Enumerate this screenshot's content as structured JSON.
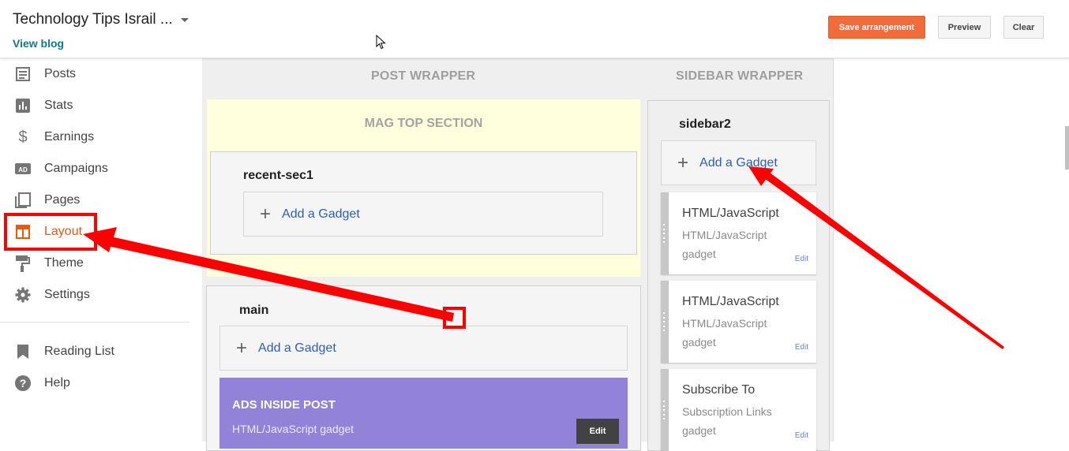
{
  "header": {
    "blog_title": "Technology Tips Israil ...",
    "view_blog": "View blog",
    "save_label": "Save arrangement",
    "preview_label": "Preview",
    "clear_label": "Clear"
  },
  "sidebar": {
    "items": [
      {
        "label": "Posts",
        "icon": "posts-icon"
      },
      {
        "label": "Stats",
        "icon": "stats-icon"
      },
      {
        "label": "Earnings",
        "icon": "dollar-icon"
      },
      {
        "label": "Campaigns",
        "icon": "ad-icon"
      },
      {
        "label": "Pages",
        "icon": "pages-icon"
      },
      {
        "label": "Layout",
        "icon": "layout-icon",
        "active": true
      },
      {
        "label": "Theme",
        "icon": "paint-roller-icon"
      },
      {
        "label": "Settings",
        "icon": "gear-icon"
      }
    ],
    "secondary": [
      {
        "label": "Reading List",
        "icon": "bookmark-icon"
      },
      {
        "label": "Help",
        "icon": "help-icon"
      }
    ]
  },
  "layout": {
    "post_wrapper_title": "POST WRAPPER",
    "sidebar_wrapper_title": "SIDEBAR WRAPPER",
    "mag_top_title": "MAG TOP SECTION",
    "recent_sec_name": "recent-sec1",
    "main_name": "main",
    "sidebar2_name": "sidebar2",
    "add_gadget": "Add a Gadget",
    "ads": {
      "title": "ADS INSIDE POST",
      "subtitle": "HTML/JavaScript gadget",
      "edit": "Edit"
    },
    "gadgets": [
      {
        "title": "HTML/JavaScript",
        "subtitle": "HTML/JavaScript gadget",
        "edit": "Edit"
      },
      {
        "title": "HTML/JavaScript",
        "subtitle": "HTML/JavaScript gadget",
        "edit": "Edit"
      },
      {
        "title": "Subscribe To",
        "subtitle": "Subscription Links gadget",
        "edit": "Edit"
      }
    ]
  },
  "colors": {
    "accent": "#e8590c",
    "save_button": "#f26b3a",
    "link": "#2c5fb4",
    "annotation": "#ff0000",
    "ads_gadget": "#9283d8"
  }
}
